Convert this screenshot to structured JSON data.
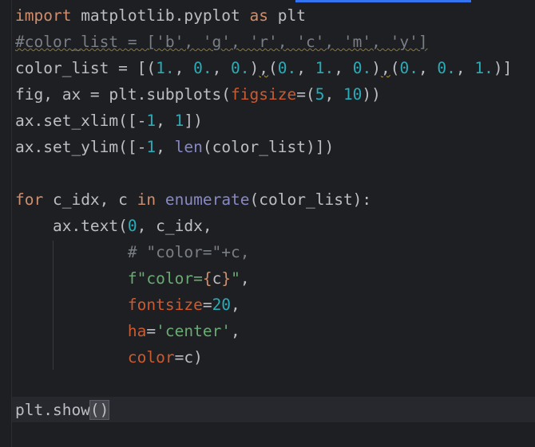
{
  "editor": {
    "lines": {
      "l1": {
        "kw1": "import",
        "t1": " matplotlib.pyplot ",
        "kw2": "as",
        "t2": " plt"
      },
      "l2": {
        "comment": "#color_list = ['b', 'g', 'r', 'c', 'm', 'y']"
      },
      "l3": {
        "a": "color_list = [(",
        "n1": "1.",
        "s1": ", ",
        "n2": "0.",
        "s2": ", ",
        "n3": "0.",
        "s3": ")",
        "c1": ",",
        "s4": "(",
        "n4": "0.",
        "s5": ", ",
        "n5": "1.",
        "s6": ", ",
        "n6": "0.",
        "s7": ")",
        "c2": ",",
        "s8": "(",
        "n7": "0.",
        "s9": ", ",
        "n8": "0.",
        "s10": ", ",
        "n9": "1.",
        "s11": ")]"
      },
      "l4": {
        "a": "fig, ax = plt.subplots(",
        "param": "figsize",
        "b": "=(",
        "n1": "5",
        "c": ", ",
        "n2": "10",
        "d": "))"
      },
      "l5": {
        "a": "ax.set_xlim([-",
        "n1": "1",
        "b": ", ",
        "n2": "1",
        "c": "])"
      },
      "l6": {
        "a": "ax.set_ylim([-",
        "n1": "1",
        "b": ", ",
        "builtin": "len",
        "c": "(color_list)])"
      },
      "l8": {
        "kw1": "for",
        "a": " c_idx, c ",
        "kw2": "in",
        "sp": " ",
        "builtin": "enumerate",
        "b": "(color_list):"
      },
      "l9": {
        "a": "    ax.text(",
        "n1": "0",
        "b": ", c_idx,"
      },
      "l10": {
        "indent": "            ",
        "comment": "# \"color=\"+c,"
      },
      "l11": {
        "indent": "            ",
        "f": "f\"color=",
        "lb": "{",
        "c": "c",
        "rb": "}",
        "q": "\"",
        "comma": ","
      },
      "l12": {
        "indent": "            ",
        "kwarg": "fontsize",
        "eq": "=",
        "n": "20",
        "comma": ","
      },
      "l13": {
        "indent": "            ",
        "kwarg": "ha",
        "eq": "=",
        "str": "'center'",
        "comma": ","
      },
      "l14": {
        "indent": "            ",
        "kwarg": "color",
        "rest": "=c)"
      },
      "l16": {
        "a": "plt.show",
        "p": "()"
      }
    }
  },
  "colors": {
    "background": "#1e1f22",
    "accent": "#3574f0",
    "keyword": "#cf8e6d",
    "number": "#2aacb8",
    "string": "#6aab73",
    "comment": "#7a7e85"
  }
}
